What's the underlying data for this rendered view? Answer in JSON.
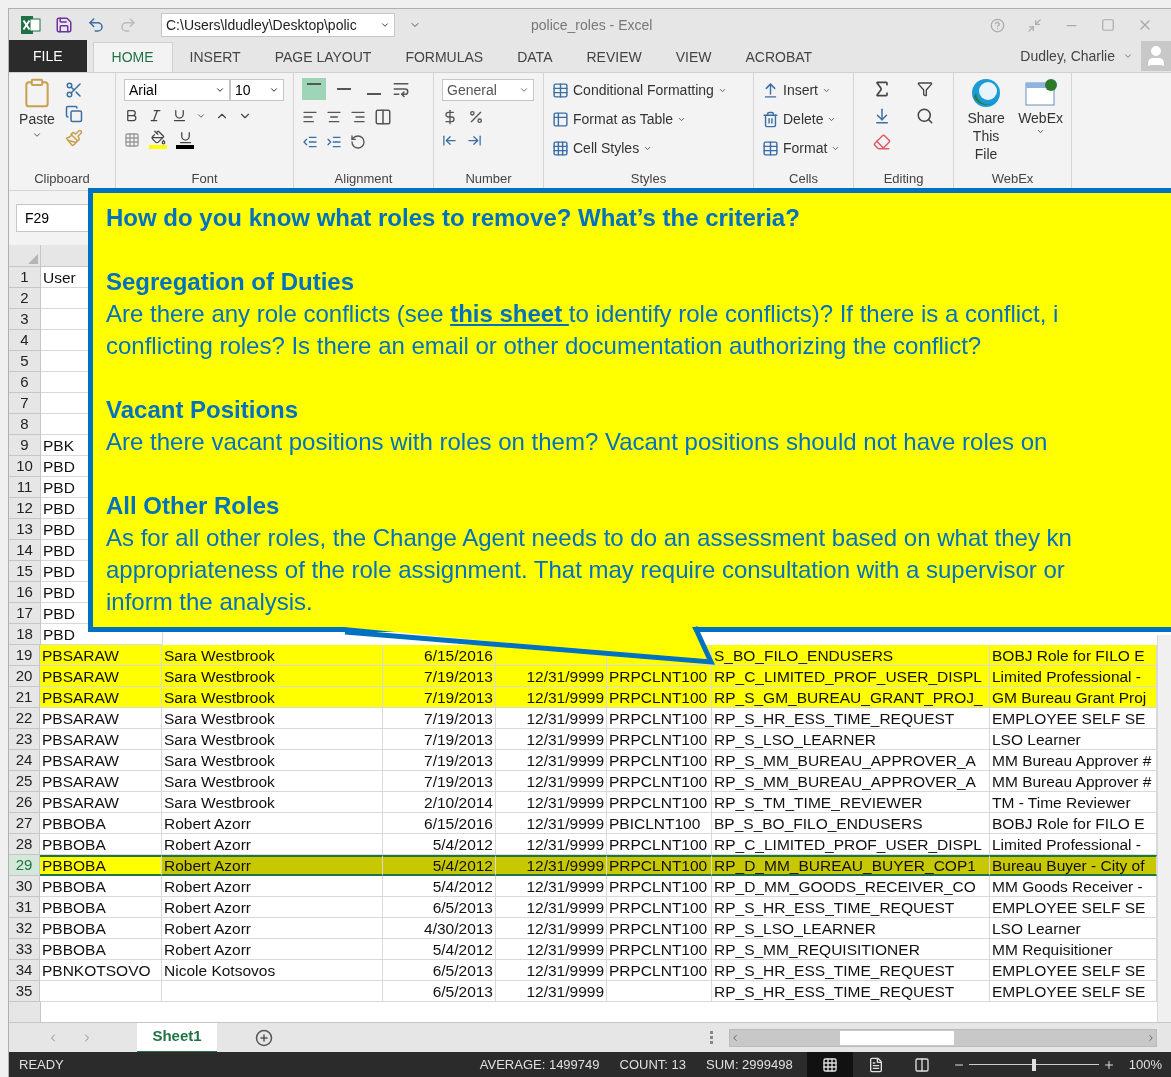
{
  "title_bar": {
    "path": "C:\\Users\\ldudley\\Desktop\\polic",
    "title": "police_roles - Excel"
  },
  "tabs": [
    {
      "label": "FILE",
      "kind": "file",
      "selected": false
    },
    {
      "label": "HOME",
      "kind": "tab",
      "selected": true
    },
    {
      "label": "INSERT",
      "kind": "tab",
      "selected": false
    },
    {
      "label": "PAGE LAYOUT",
      "kind": "tab",
      "selected": false
    },
    {
      "label": "FORMULAS",
      "kind": "tab",
      "selected": false
    },
    {
      "label": "DATA",
      "kind": "tab",
      "selected": false
    },
    {
      "label": "REVIEW",
      "kind": "tab",
      "selected": false
    },
    {
      "label": "VIEW",
      "kind": "tab",
      "selected": false
    },
    {
      "label": "ACROBAT",
      "kind": "tab",
      "selected": false
    }
  ],
  "user": {
    "name": "Dudley, Charlie"
  },
  "ribbon": [
    {
      "kind": "clipboard",
      "label": "Clipboard",
      "paste": "Paste"
    },
    {
      "kind": "font",
      "label": "Font",
      "font_name": "Arial",
      "font_size": "10"
    },
    {
      "kind": "alignment",
      "label": "Alignment",
      "vertical_align": [
        {
          "selected": true
        },
        {
          "selected": false
        },
        {
          "selected": false
        }
      ]
    },
    {
      "kind": "number",
      "label": "Number",
      "format": "General"
    },
    {
      "kind": "styles",
      "label": "Styles",
      "items": [
        "Conditional Formatting",
        "Format as Table",
        "Cell Styles"
      ]
    },
    {
      "kind": "cells",
      "label": "Cells",
      "items": [
        "Insert",
        "Delete",
        "Format"
      ]
    },
    {
      "kind": "editing",
      "label": "Editing"
    },
    {
      "kind": "webex",
      "label": "WebEx",
      "items": [
        "Share This File",
        "WebEx"
      ]
    }
  ],
  "name_box": {
    "value": "F29"
  },
  "callout": {
    "question": "How do you know what roles to remove?  What’s the criteria?",
    "sections": [
      {
        "heading": "Segregation of Duties",
        "lines": [
          [
            {
              "kind": "plain",
              "text": "Are there any role conflicts (see "
            },
            {
              "kind": "link",
              "text": "this sheet "
            },
            {
              "kind": "plain",
              "text": "to identify role conflicts)?  If there is a conflict, i"
            }
          ],
          [
            {
              "kind": "plain",
              "text": "conflicting roles?  Is there an email or other documentation authorizing the conflict?"
            }
          ]
        ]
      },
      {
        "heading": "Vacant Positions",
        "lines": [
          [
            {
              "kind": "plain",
              "text": "Are there vacant positions with roles on them?   Vacant positions should not have roles on"
            }
          ]
        ]
      },
      {
        "heading": "All Other Roles",
        "lines": [
          [
            {
              "kind": "plain",
              "text": "As for all other roles, the Change Agent needs to do an assessment based on what they kn"
            }
          ],
          [
            {
              "kind": "plain",
              "text": "appropriateness of the role assignment.  That may require consultation with a supervisor or"
            }
          ],
          [
            {
              "kind": "plain",
              "text": "inform the analysis."
            }
          ]
        ]
      }
    ]
  },
  "sheet": {
    "rows": [
      {
        "number": "1",
        "cells": [
          "User"
        ],
        "highlighted": false,
        "selected": false
      },
      {
        "number": "2",
        "cells": [],
        "highlighted": false,
        "selected": false
      },
      {
        "number": "3",
        "cells": [],
        "highlighted": false,
        "selected": false
      },
      {
        "number": "4",
        "cells": [],
        "highlighted": false,
        "selected": false
      },
      {
        "number": "5",
        "cells": [],
        "highlighted": false,
        "selected": false
      },
      {
        "number": "6",
        "cells": [],
        "highlighted": false,
        "selected": false
      },
      {
        "number": "7",
        "cells": [],
        "highlighted": false,
        "selected": false
      },
      {
        "number": "8",
        "cells": [],
        "highlighted": false,
        "selected": false
      },
      {
        "number": "9",
        "cells": [
          "PBK"
        ],
        "highlighted": false,
        "selected": false
      },
      {
        "number": "10",
        "cells": [
          "PBD"
        ],
        "highlighted": false,
        "selected": false
      },
      {
        "number": "11",
        "cells": [
          "PBD"
        ],
        "highlighted": false,
        "selected": false
      },
      {
        "number": "12",
        "cells": [
          "PBD"
        ],
        "highlighted": false,
        "selected": false
      },
      {
        "number": "13",
        "cells": [
          "PBD"
        ],
        "highlighted": false,
        "selected": false
      },
      {
        "number": "14",
        "cells": [
          "PBD"
        ],
        "highlighted": false,
        "selected": false
      },
      {
        "number": "15",
        "cells": [
          "PBD"
        ],
        "highlighted": false,
        "selected": false
      },
      {
        "number": "16",
        "cells": [
          "PBD"
        ],
        "highlighted": false,
        "selected": false
      },
      {
        "number": "17",
        "cells": [
          "PBD"
        ],
        "highlighted": false,
        "selected": false
      },
      {
        "number": "18",
        "cells": [
          "PBD"
        ],
        "highlighted": false,
        "selected": false
      },
      {
        "number": "19",
        "cells": [
          "PBSARAW",
          "Sara Westbrook",
          "6/15/2016",
          null,
          null,
          "S_BO_FILO_ENDUSERS",
          "BOBJ Role for FILO E"
        ],
        "highlighted": true,
        "selected": false
      },
      {
        "number": "20",
        "cells": [
          "PBSARAW",
          "Sara Westbrook",
          "7/19/2013",
          "12/31/9999",
          "PRPCLNT100",
          "RP_C_LIMITED_PROF_USER_DISPL",
          "Limited Professional -"
        ],
        "highlighted": true,
        "selected": false
      },
      {
        "number": "21",
        "cells": [
          "PBSARAW",
          "Sara Westbrook",
          "7/19/2013",
          "12/31/9999",
          "PRPCLNT100",
          "RP_S_GM_BUREAU_GRANT_PROJ_",
          "GM Bureau Grant Proj"
        ],
        "highlighted": true,
        "selected": false
      },
      {
        "number": "22",
        "cells": [
          "PBSARAW",
          "Sara Westbrook",
          "7/19/2013",
          "12/31/9999",
          "PRPCLNT100",
          "RP_S_HR_ESS_TIME_REQUEST",
          "EMPLOYEE SELF SE"
        ],
        "highlighted": false,
        "selected": false
      },
      {
        "number": "23",
        "cells": [
          "PBSARAW",
          "Sara Westbrook",
          "7/19/2013",
          "12/31/9999",
          "PRPCLNT100",
          "RP_S_LSO_LEARNER",
          "LSO Learner"
        ],
        "highlighted": false,
        "selected": false
      },
      {
        "number": "24",
        "cells": [
          "PBSARAW",
          "Sara Westbrook",
          "7/19/2013",
          "12/31/9999",
          "PRPCLNT100",
          "RP_S_MM_BUREAU_APPROVER_A",
          "MM Bureau Approver #"
        ],
        "highlighted": false,
        "selected": false
      },
      {
        "number": "25",
        "cells": [
          "PBSARAW",
          "Sara Westbrook",
          "7/19/2013",
          "12/31/9999",
          "PRPCLNT100",
          "RP_S_MM_BUREAU_APPROVER_A",
          "MM Bureau Approver #"
        ],
        "highlighted": false,
        "selected": false
      },
      {
        "number": "26",
        "cells": [
          "PBSARAW",
          "Sara Westbrook",
          "2/10/2014",
          "12/31/9999",
          "PRPCLNT100",
          "RP_S_TM_TIME_REVIEWER",
          "TM - Time Reviewer"
        ],
        "highlighted": false,
        "selected": false
      },
      {
        "number": "27",
        "cells": [
          "PBBOBA",
          "Robert Azorr",
          "6/15/2016",
          "12/31/9999",
          "PBICLNT100",
          "BP_S_BO_FILO_ENDUSERS",
          "BOBJ Role for FILO E"
        ],
        "highlighted": false,
        "selected": false
      },
      {
        "number": "28",
        "cells": [
          "PBBOBA",
          "Robert Azorr",
          "5/4/2012",
          "12/31/9999",
          "PRPCLNT100",
          "RP_C_LIMITED_PROF_USER_DISPL",
          "Limited Professional -"
        ],
        "highlighted": false,
        "selected": false
      },
      {
        "number": "29",
        "cells": [
          "PBBOBA",
          "Robert Azorr",
          "5/4/2012",
          "12/31/9999",
          "PRPCLNT100",
          "RP_D_MM_BUREAU_BUYER_COP1",
          "Bureau Buyer - City of"
        ],
        "highlighted": true,
        "selected": true
      },
      {
        "number": "30",
        "cells": [
          "PBBOBA",
          "Robert Azorr",
          "5/4/2012",
          "12/31/9999",
          "PRPCLNT100",
          "RP_D_MM_GOODS_RECEIVER_CO",
          "MM Goods Receiver -"
        ],
        "highlighted": false,
        "selected": false
      },
      {
        "number": "31",
        "cells": [
          "PBBOBA",
          "Robert Azorr",
          "6/5/2013",
          "12/31/9999",
          "PRPCLNT100",
          "RP_S_HR_ESS_TIME_REQUEST",
          "EMPLOYEE SELF SE"
        ],
        "highlighted": false,
        "selected": false
      },
      {
        "number": "32",
        "cells": [
          "PBBOBA",
          "Robert Azorr",
          "4/30/2013",
          "12/31/9999",
          "PRPCLNT100",
          "RP_S_LSO_LEARNER",
          "LSO Learner"
        ],
        "highlighted": false,
        "selected": false
      },
      {
        "number": "33",
        "cells": [
          "PBBOBA",
          "Robert Azorr",
          "5/4/2012",
          "12/31/9999",
          "PRPCLNT100",
          "RP_S_MM_REQUISITIONER",
          "MM Requisitioner"
        ],
        "highlighted": false,
        "selected": false
      },
      {
        "number": "34",
        "cells": [
          "PBNKOTSOVO",
          "Nicole Kotsovos",
          "6/5/2013",
          "12/31/9999",
          "PRPCLNT100",
          "RP_S_HR_ESS_TIME_REQUEST",
          "EMPLOYEE SELF SE"
        ],
        "highlighted": false,
        "selected": false
      },
      {
        "number": "35",
        "cells": [
          null,
          null,
          "6/5/2013",
          "12/31/9999",
          null,
          "RP_S_HR_ESS_TIME_REQUEST",
          "EMPLOYEE SELF SE"
        ],
        "highlighted": false,
        "selected": false
      }
    ]
  },
  "sheet_tabs": [
    {
      "label": "Sheet1",
      "selected": true
    }
  ],
  "status_bar": {
    "mode": "READY",
    "average": "AVERAGE: 1499749",
    "count": "COUNT: 13",
    "sum": "SUM: 2999498",
    "views": [
      {
        "kind": "normal",
        "selected": true
      },
      {
        "kind": "page_layout",
        "selected": false
      },
      {
        "kind": "page_break",
        "selected": false
      }
    ],
    "zoom": {
      "level": 0.5,
      "label": "100%"
    }
  }
}
